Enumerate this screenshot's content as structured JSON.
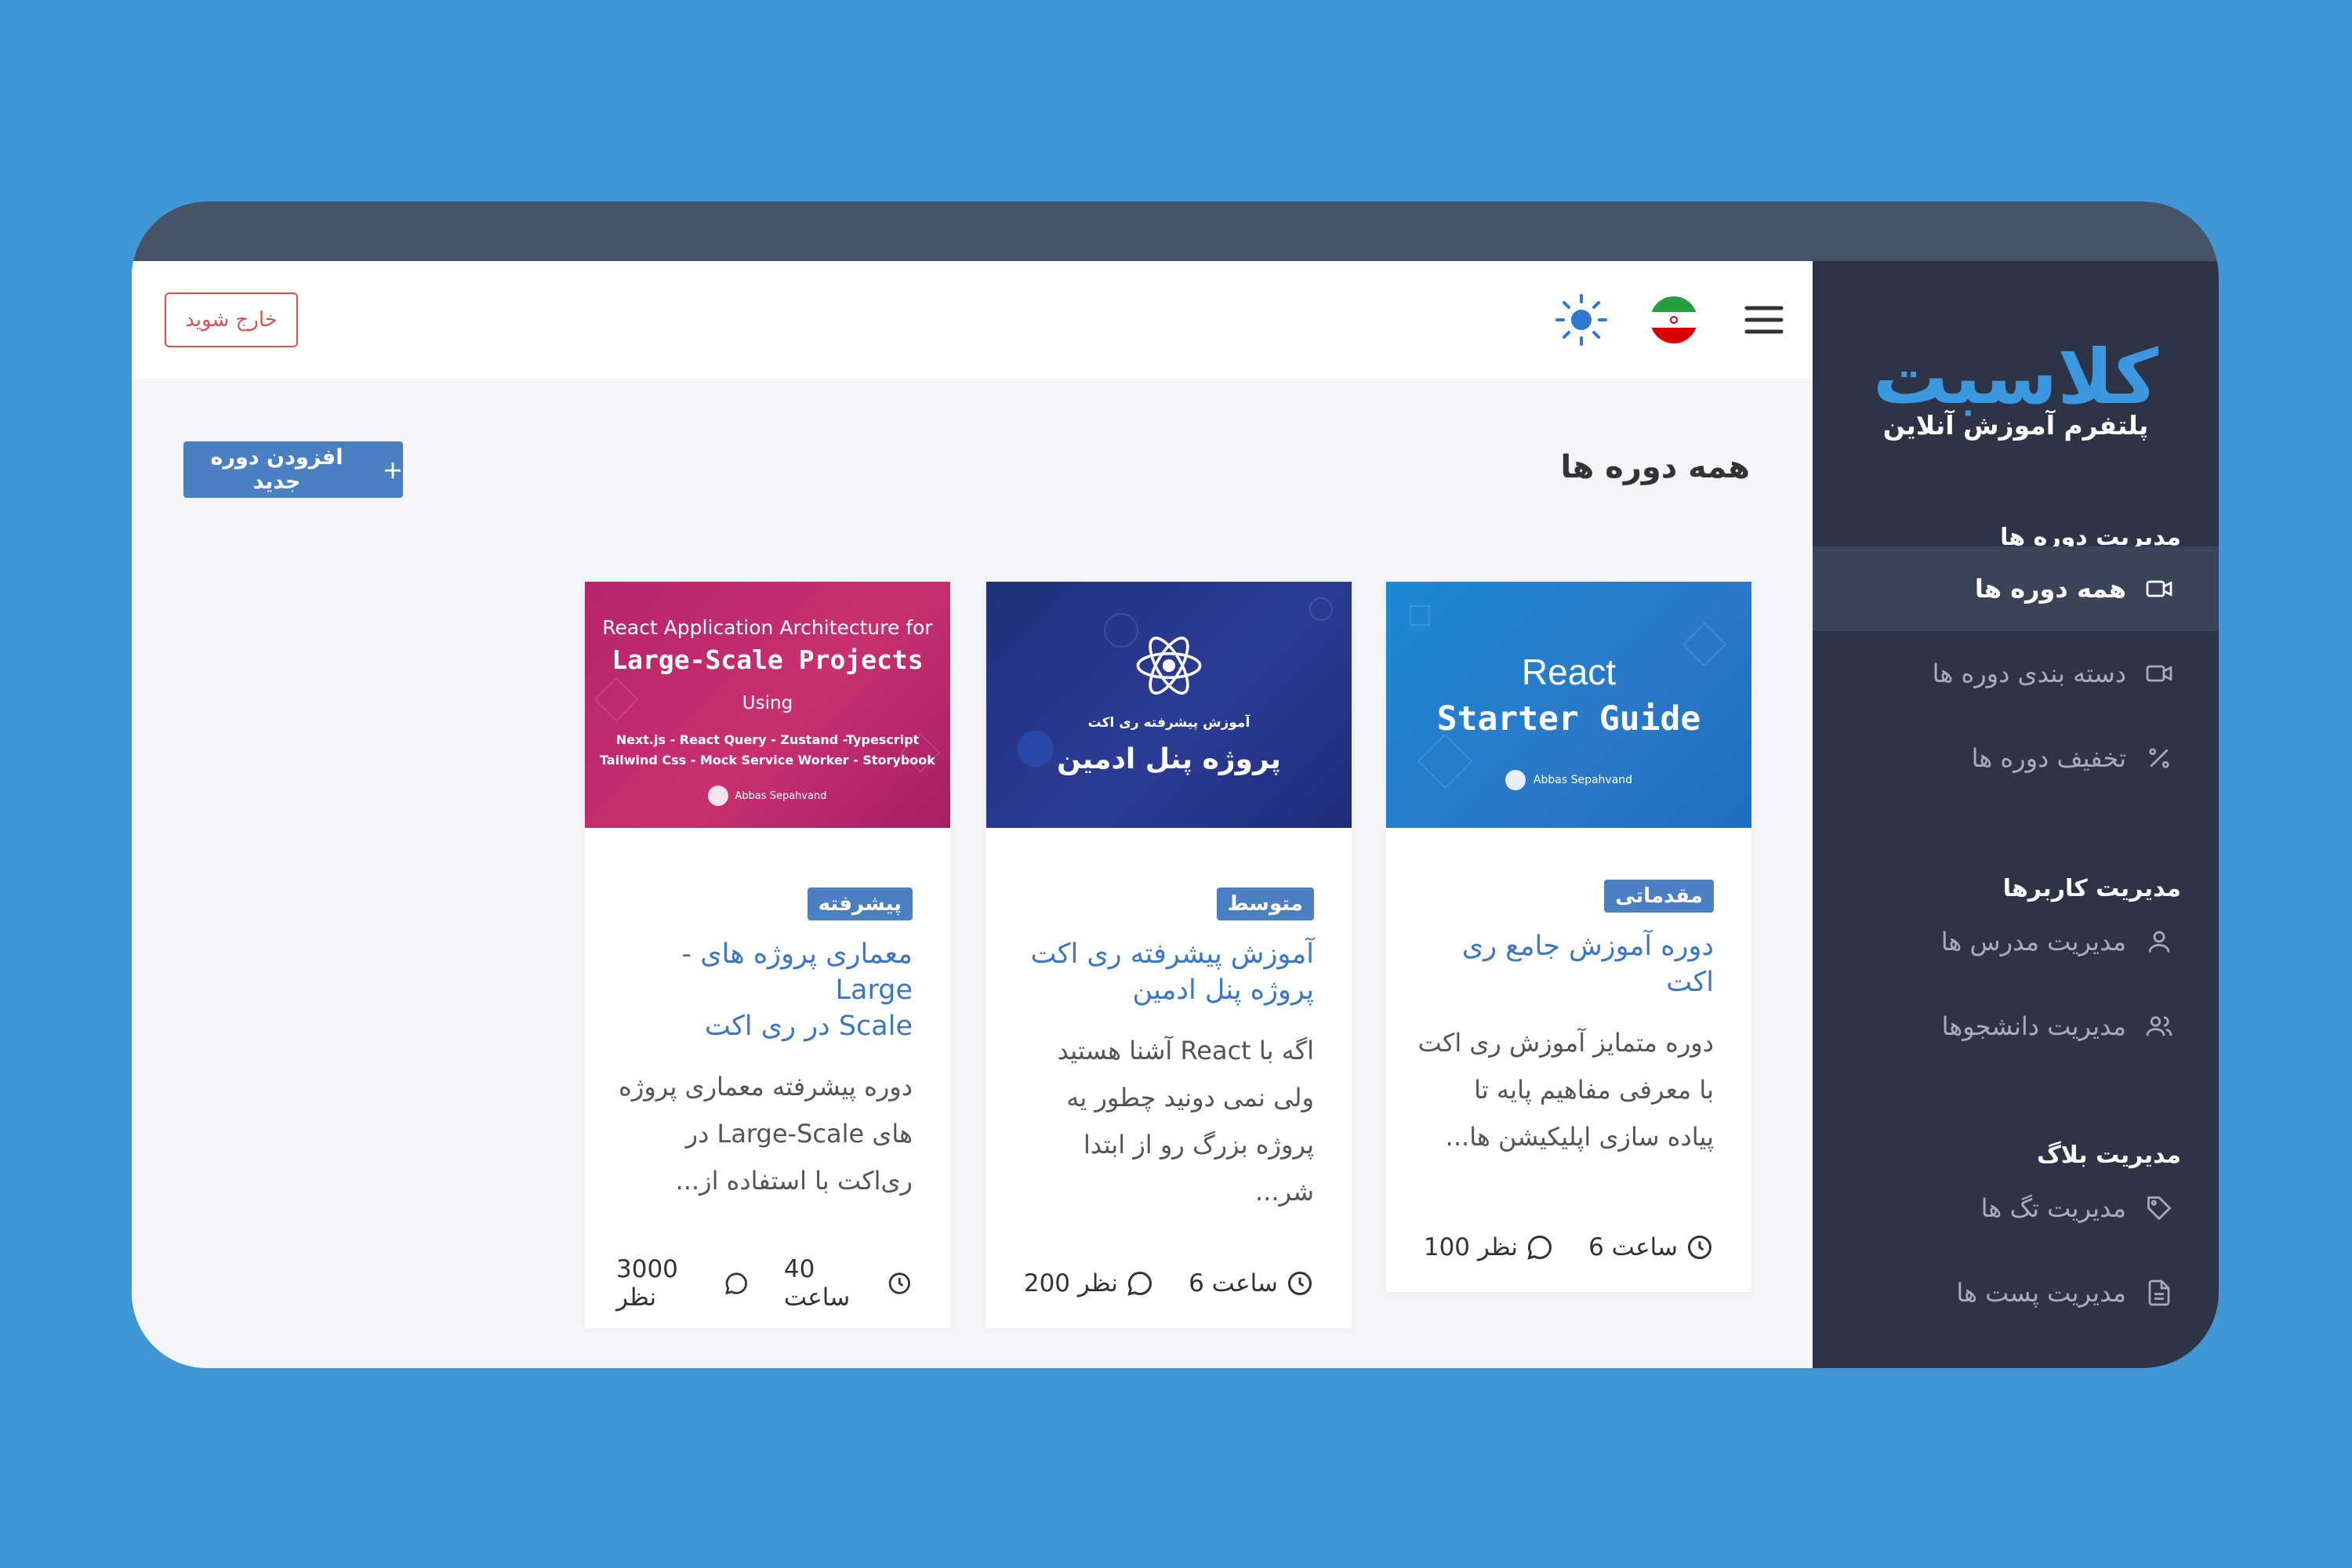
{
  "sidebar": {
    "logo": "کلاسبت",
    "tagline": "پلتفرم آموزش آنلاین",
    "sections": [
      {
        "title": "مدیریت دوره ها",
        "items": [
          {
            "label": "همه دوره ها",
            "icon": "video-icon",
            "active": true
          },
          {
            "label": "دسته بندی دوره ها",
            "icon": "video-icon"
          },
          {
            "label": "تخفیف دوره ها",
            "icon": "percent-icon"
          }
        ]
      },
      {
        "title": "مدیریت کاربرها",
        "items": [
          {
            "label": "مدیریت مدرس ها",
            "icon": "user-icon"
          },
          {
            "label": "مدیریت دانشجوها",
            "icon": "users-icon"
          }
        ]
      },
      {
        "title": "مدیریت بلاگ",
        "items": [
          {
            "label": "مدیریت تگ ها",
            "icon": "tag-icon"
          },
          {
            "label": "مدیریت پست ها",
            "icon": "document-icon"
          }
        ]
      }
    ]
  },
  "header": {
    "logout_label": "خارج شوید",
    "icons": [
      "sun-icon",
      "iran-flag-icon",
      "hamburger-menu-icon"
    ]
  },
  "main": {
    "title": "همه دوره ها",
    "add_button_label": "افزودن دوره جدید",
    "add_button_icon": "plus-icon"
  },
  "courses": [
    {
      "thumb": {
        "line1": "React",
        "line2": "Starter Guide",
        "author": "Abbas Sepahvand"
      },
      "level": "مقدماتی",
      "title": "دوره آموزش جامع ری اکت",
      "desc_lines": [
        "دوره متمایز آموزش ری اکت",
        "با معرفی مفاهیم پایه تا",
        "پیاده سازی اپلیکیشن ها..."
      ],
      "hours": "6 ساعت",
      "comments": "100 نظر"
    },
    {
      "thumb": {
        "line1": "آموزش پیشرفته ری اکت",
        "line2": "پروژه پنل ادمین"
      },
      "level": "متوسط",
      "title_lines": [
        "آموزش پیشرفته ری اکت",
        "پروژه پنل ادمین"
      ],
      "desc_lines": [
        "اگه با React آشنا هستید",
        "ولی نمی دونید چطور یه",
        "پروژه بزرگ رو از ابتدا شر..."
      ],
      "hours": "6 ساعت",
      "comments": "200 نظر"
    },
    {
      "thumb": {
        "line1": "React Application Architecture for",
        "line2": "Large-Scale Projects",
        "line3": "Using",
        "line4": "Next.js - React Query - Zustand -Typescript",
        "line5": "Tailwind Css - Mock Service Worker - Storybook",
        "author": "Abbas Sepahvand"
      },
      "level": "پیشرفته",
      "title_lines": [
        "معماری پروژه های -Large",
        "Scale در ری اکت"
      ],
      "desc_lines": [
        "دوره پیشرفته معماری پروژه",
        "های Large-Scale در",
        "ری‌اکت با استفاده از..."
      ],
      "hours": "40 ساعت",
      "comments": "3000 نظر"
    }
  ],
  "colors": {
    "background": "#3f97d5",
    "sidebar": "#2d3446",
    "accent": "#4a7fc1",
    "logout": "#d9534f",
    "title_link": "#3d76c2"
  }
}
